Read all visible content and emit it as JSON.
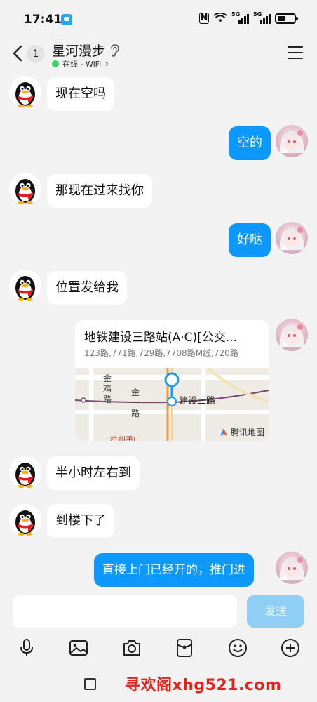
{
  "status_bar": {
    "time": "17:41",
    "network_label": "5G"
  },
  "header": {
    "unread_count": "1",
    "contact_name": "星河漫步",
    "presence": "在线 - WiFi",
    "presence_chevron": "›"
  },
  "messages": [
    {
      "side": "in",
      "text": "现在空吗"
    },
    {
      "side": "out",
      "text": "空的"
    },
    {
      "side": "in",
      "text": "那现在过来找你"
    },
    {
      "side": "out",
      "text": "好哒"
    },
    {
      "side": "in",
      "text": "位置发给我"
    },
    {
      "side": "out",
      "type": "location"
    },
    {
      "side": "in",
      "text": "半小时左右到"
    },
    {
      "side": "in",
      "text": "到楼下了"
    },
    {
      "side": "out",
      "text": "直接上门已经开的，推门进"
    }
  ],
  "location_card": {
    "title": "地铁建设三路站(A·C)[公交...",
    "subtitle": "123路,771路,729路,7708路M线,720路",
    "map_labels": {
      "road_a": "金鸡路",
      "road_b": "金一路",
      "station": "建设三路",
      "partial": "杭州萧山"
    },
    "brand": "腾讯地图"
  },
  "composer": {
    "input_value": "",
    "send_label": "发送"
  },
  "toolbar_icons": [
    "microphone-icon",
    "image-icon",
    "camera-icon",
    "red-packet-icon",
    "emoji-icon",
    "plus-icon"
  ],
  "watermark": "寻欢阁xhg521.com",
  "colors": {
    "outgoing_bubble": "#0c98fd",
    "incoming_bubble": "#ffffff",
    "send_button_disabled": "#8fcff6",
    "online": "#3ed06a",
    "watermark": "#e0231c"
  }
}
